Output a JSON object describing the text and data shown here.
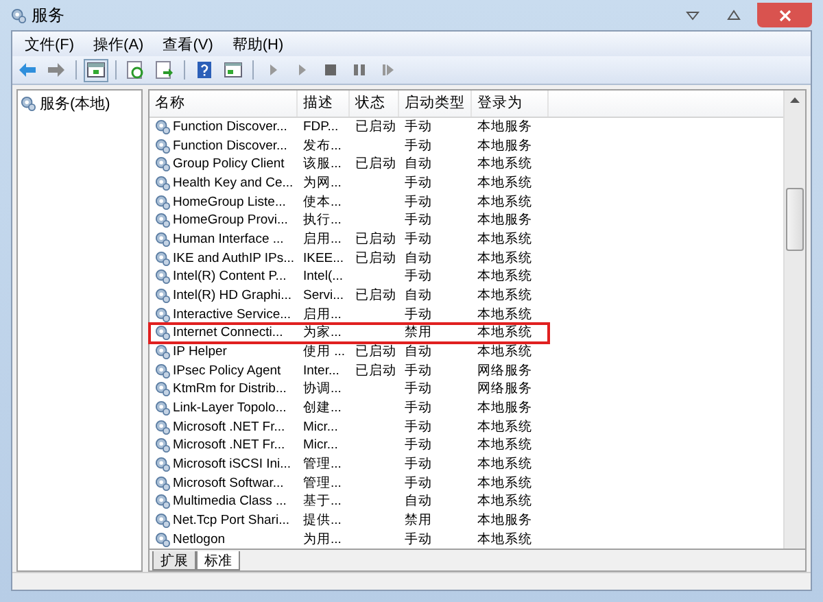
{
  "window": {
    "title": "服务"
  },
  "menu": [
    "文件(F)",
    "操作(A)",
    "查看(V)",
    "帮助(H)"
  ],
  "tree": [
    {
      "label": "服务(本地)",
      "selected": false
    }
  ],
  "table": {
    "columns": [
      "名称",
      "描述",
      "状态",
      "启动类型",
      "登录为"
    ],
    "rows": [
      {
        "cells": [
          "Function Discover...",
          "FDP...",
          "已启动",
          "手动",
          "本地服务"
        ],
        "highlighted": false
      },
      {
        "cells": [
          "Function Discover...",
          "发布...",
          "",
          "手动",
          "本地服务"
        ],
        "highlighted": false
      },
      {
        "cells": [
          "Group Policy Client",
          "该服...",
          "已启动",
          "自动",
          "本地系统"
        ],
        "highlighted": false
      },
      {
        "cells": [
          "Health Key and Ce...",
          "为网...",
          "",
          "手动",
          "本地系统"
        ],
        "highlighted": false
      },
      {
        "cells": [
          "HomeGroup Liste...",
          "使本...",
          "",
          "手动",
          "本地系统"
        ],
        "highlighted": false
      },
      {
        "cells": [
          "HomeGroup Provi...",
          "执行...",
          "",
          "手动",
          "本地服务"
        ],
        "highlighted": false
      },
      {
        "cells": [
          "Human Interface ...",
          "启用...",
          "已启动",
          "手动",
          "本地系统"
        ],
        "highlighted": false
      },
      {
        "cells": [
          "IKE and AuthIP IPs...",
          "IKEE...",
          "已启动",
          "自动",
          "本地系统"
        ],
        "highlighted": false
      },
      {
        "cells": [
          "Intel(R) Content P...",
          "Intel(...",
          "",
          "手动",
          "本地系统"
        ],
        "highlighted": false
      },
      {
        "cells": [
          "Intel(R) HD Graphi...",
          "Servi...",
          "已启动",
          "自动",
          "本地系统"
        ],
        "highlighted": false
      },
      {
        "cells": [
          "Interactive Service...",
          "启用...",
          "",
          "手动",
          "本地系统"
        ],
        "highlighted": false
      },
      {
        "cells": [
          "Internet Connecti...",
          "为家...",
          "",
          "禁用",
          "本地系统"
        ],
        "highlighted": true
      },
      {
        "cells": [
          "IP Helper",
          "使用 ...",
          "已启动",
          "自动",
          "本地系统"
        ],
        "highlighted": false
      },
      {
        "cells": [
          "IPsec Policy Agent",
          "Inter...",
          "已启动",
          "手动",
          "网络服务"
        ],
        "highlighted": false
      },
      {
        "cells": [
          "KtmRm for Distrib...",
          "协调...",
          "",
          "手动",
          "网络服务"
        ],
        "highlighted": false
      },
      {
        "cells": [
          "Link-Layer Topolo...",
          "创建...",
          "",
          "手动",
          "本地服务"
        ],
        "highlighted": false
      },
      {
        "cells": [
          "Microsoft .NET Fr...",
          "Micr...",
          "",
          "手动",
          "本地系统"
        ],
        "highlighted": false
      },
      {
        "cells": [
          "Microsoft .NET Fr...",
          "Micr...",
          "",
          "手动",
          "本地系统"
        ],
        "highlighted": false
      },
      {
        "cells": [
          "Microsoft iSCSI Ini...",
          "管理...",
          "",
          "手动",
          "本地系统"
        ],
        "highlighted": false
      },
      {
        "cells": [
          "Microsoft Softwar...",
          "管理...",
          "",
          "手动",
          "本地系统"
        ],
        "highlighted": false
      },
      {
        "cells": [
          "Multimedia Class ...",
          "基于...",
          "",
          "自动",
          "本地系统"
        ],
        "highlighted": false
      },
      {
        "cells": [
          "Net.Tcp Port Shari...",
          "提供...",
          "",
          "禁用",
          "本地服务"
        ],
        "highlighted": false
      },
      {
        "cells": [
          "Netlogon",
          "为用...",
          "",
          "手动",
          "本地系统"
        ],
        "highlighted": false
      }
    ]
  },
  "tabs": [
    {
      "label": "扩展",
      "selected": false
    },
    {
      "label": "标准",
      "selected": true
    }
  ]
}
